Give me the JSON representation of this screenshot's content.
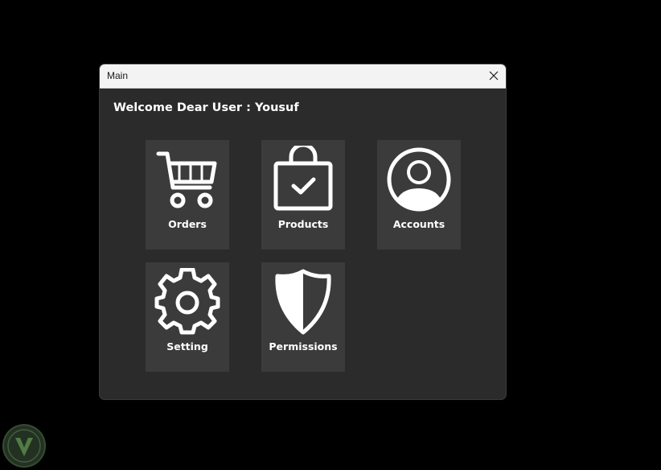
{
  "window": {
    "title": "Main",
    "close_icon": "close-icon"
  },
  "welcome": {
    "text": "Welcome Dear User : Yousuf"
  },
  "tiles": [
    {
      "label": "Orders",
      "icon": "shopping-cart-icon"
    },
    {
      "label": "Products",
      "icon": "shopping-bag-check-icon"
    },
    {
      "label": "Accounts",
      "icon": "user-circle-icon"
    },
    {
      "label": "Setting",
      "icon": "gear-icon"
    },
    {
      "label": "Permissions",
      "icon": "shield-icon"
    }
  ],
  "colors": {
    "desktop": "#000000",
    "window_body": "#2b2b2b",
    "tile": "#3b3b3b",
    "titlebar": "#f3f3f3",
    "text": "#ffffff"
  }
}
